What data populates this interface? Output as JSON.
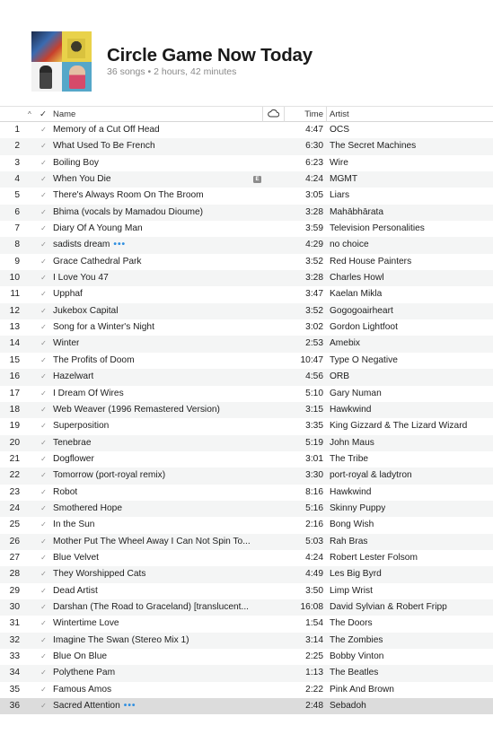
{
  "playlist": {
    "title": "Circle Game Now Today",
    "summary": "36 songs • 2 hours, 42 minutes"
  },
  "columns": {
    "sort_indicator": "^",
    "check": "✓",
    "name": "Name",
    "cloud_icon": "cloud-icon",
    "time": "Time",
    "artist": "Artist"
  },
  "colors": {
    "stripe": "#f4f5f5",
    "selected": "#dcdcdc",
    "more_dots": "#2f8fe0"
  },
  "tracks": [
    {
      "num": "1",
      "name": "Memory of a Cut Off Head",
      "time": "4:47",
      "artist": "OCS"
    },
    {
      "num": "2",
      "name": "What Used To Be French",
      "time": "6:30",
      "artist": "The Secret Machines"
    },
    {
      "num": "3",
      "name": "Boiling Boy",
      "time": "6:23",
      "artist": "Wire"
    },
    {
      "num": "4",
      "name": "When You Die",
      "time": "4:24",
      "artist": "MGMT",
      "explicit": "E"
    },
    {
      "num": "5",
      "name": "There's Always Room On The Broom",
      "time": "3:05",
      "artist": "Liars"
    },
    {
      "num": "6",
      "name": "Bhima (vocals by Mamadou Dioume)",
      "time": "3:28",
      "artist": "Mahābhārata"
    },
    {
      "num": "7",
      "name": "Diary Of A Young Man",
      "time": "3:59",
      "artist": "Television Personalities"
    },
    {
      "num": "8",
      "name": "sadists dream",
      "time": "4:29",
      "artist": "no choice",
      "more": "•••"
    },
    {
      "num": "9",
      "name": "Grace Cathedral Park",
      "time": "3:52",
      "artist": "Red House Painters"
    },
    {
      "num": "10",
      "name": "I Love You 47",
      "time": "3:28",
      "artist": "Charles Howl"
    },
    {
      "num": "11",
      "name": "Upphaf",
      "time": "3:47",
      "artist": "Kaelan Mikla"
    },
    {
      "num": "12",
      "name": "Jukebox Capital",
      "time": "3:52",
      "artist": "Gogogoairheart"
    },
    {
      "num": "13",
      "name": "Song for a Winter's Night",
      "time": "3:02",
      "artist": "Gordon Lightfoot"
    },
    {
      "num": "14",
      "name": "Winter",
      "time": "2:53",
      "artist": "Amebix"
    },
    {
      "num": "15",
      "name": "The Profits of Doom",
      "time": "10:47",
      "artist": "Type O Negative"
    },
    {
      "num": "16",
      "name": "Hazelwart",
      "time": "4:56",
      "artist": "ORB"
    },
    {
      "num": "17",
      "name": "I Dream Of Wires",
      "time": "5:10",
      "artist": "Gary Numan"
    },
    {
      "num": "18",
      "name": "Web Weaver (1996 Remastered Version)",
      "time": "3:15",
      "artist": "Hawkwind"
    },
    {
      "num": "19",
      "name": "Superposition",
      "time": "3:35",
      "artist": "King Gizzard & The Lizard Wizard"
    },
    {
      "num": "20",
      "name": "Tenebrae",
      "time": "5:19",
      "artist": "John Maus"
    },
    {
      "num": "21",
      "name": "Dogflower",
      "time": "3:01",
      "artist": "The Tribe"
    },
    {
      "num": "22",
      "name": "Tomorrow (port-royal remix)",
      "time": "3:30",
      "artist": "port-royal & ladytron"
    },
    {
      "num": "23",
      "name": "Robot",
      "time": "8:16",
      "artist": "Hawkwind"
    },
    {
      "num": "24",
      "name": "Smothered Hope",
      "time": "5:16",
      "artist": "Skinny Puppy"
    },
    {
      "num": "25",
      "name": "In the Sun",
      "time": "2:16",
      "artist": "Bong Wish"
    },
    {
      "num": "26",
      "name": "Mother Put The Wheel Away I Can Not Spin To...",
      "time": "5:03",
      "artist": "Rah Bras"
    },
    {
      "num": "27",
      "name": "Blue Velvet",
      "time": "4:24",
      "artist": "Robert Lester Folsom"
    },
    {
      "num": "28",
      "name": "They Worshipped Cats",
      "time": "4:49",
      "artist": "Les Big Byrd"
    },
    {
      "num": "29",
      "name": "Dead Artist",
      "time": "3:50",
      "artist": "Limp Wrist"
    },
    {
      "num": "30",
      "name": "Darshan (The Road to Graceland) [translucent...",
      "time": "16:08",
      "artist": "David Sylvian & Robert Fripp"
    },
    {
      "num": "31",
      "name": "Wintertime Love",
      "time": "1:54",
      "artist": "The Doors"
    },
    {
      "num": "32",
      "name": "Imagine The Swan (Stereo Mix 1)",
      "time": "3:14",
      "artist": "The Zombies"
    },
    {
      "num": "33",
      "name": "Blue On Blue",
      "time": "2:25",
      "artist": "Bobby Vinton"
    },
    {
      "num": "34",
      "name": "Polythene Pam",
      "time": "1:13",
      "artist": "The Beatles"
    },
    {
      "num": "35",
      "name": "Famous Amos",
      "time": "2:22",
      "artist": "Pink And Brown"
    },
    {
      "num": "36",
      "name": "Sacred Attention",
      "time": "2:48",
      "artist": "Sebadoh",
      "more": "•••",
      "selected": true
    }
  ]
}
